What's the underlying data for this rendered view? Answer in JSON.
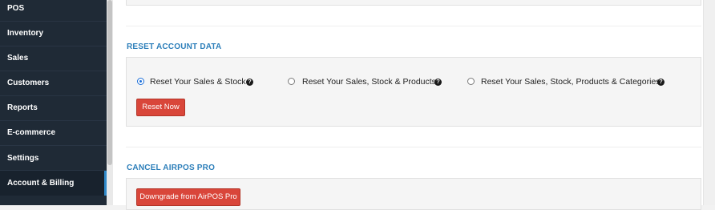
{
  "sidebar": {
    "items": [
      {
        "label": "POS"
      },
      {
        "label": "Inventory"
      },
      {
        "label": "Sales"
      },
      {
        "label": "Customers"
      },
      {
        "label": "Reports"
      },
      {
        "label": "E-commerce"
      },
      {
        "label": "Settings"
      },
      {
        "label": "Account & Billing",
        "active": true
      }
    ]
  },
  "reset": {
    "title": "RESET ACCOUNT DATA",
    "options": [
      {
        "label": "Reset Your Sales & Stock",
        "checked": true
      },
      {
        "label": "Reset Your Sales, Stock & Products",
        "checked": false
      },
      {
        "label": "Reset Your Sales, Stock, Products & Categories",
        "checked": false
      }
    ],
    "help_glyph": "?",
    "button_label": "Reset Now"
  },
  "cancel": {
    "title": "CANCEL AIRPOS PRO",
    "button_label": "Downgrade from AirPOS Pro"
  },
  "colors": {
    "sidebar_bg": "#1f2a36",
    "accent_blue": "#2d7fba",
    "danger_red": "#d9463a"
  }
}
